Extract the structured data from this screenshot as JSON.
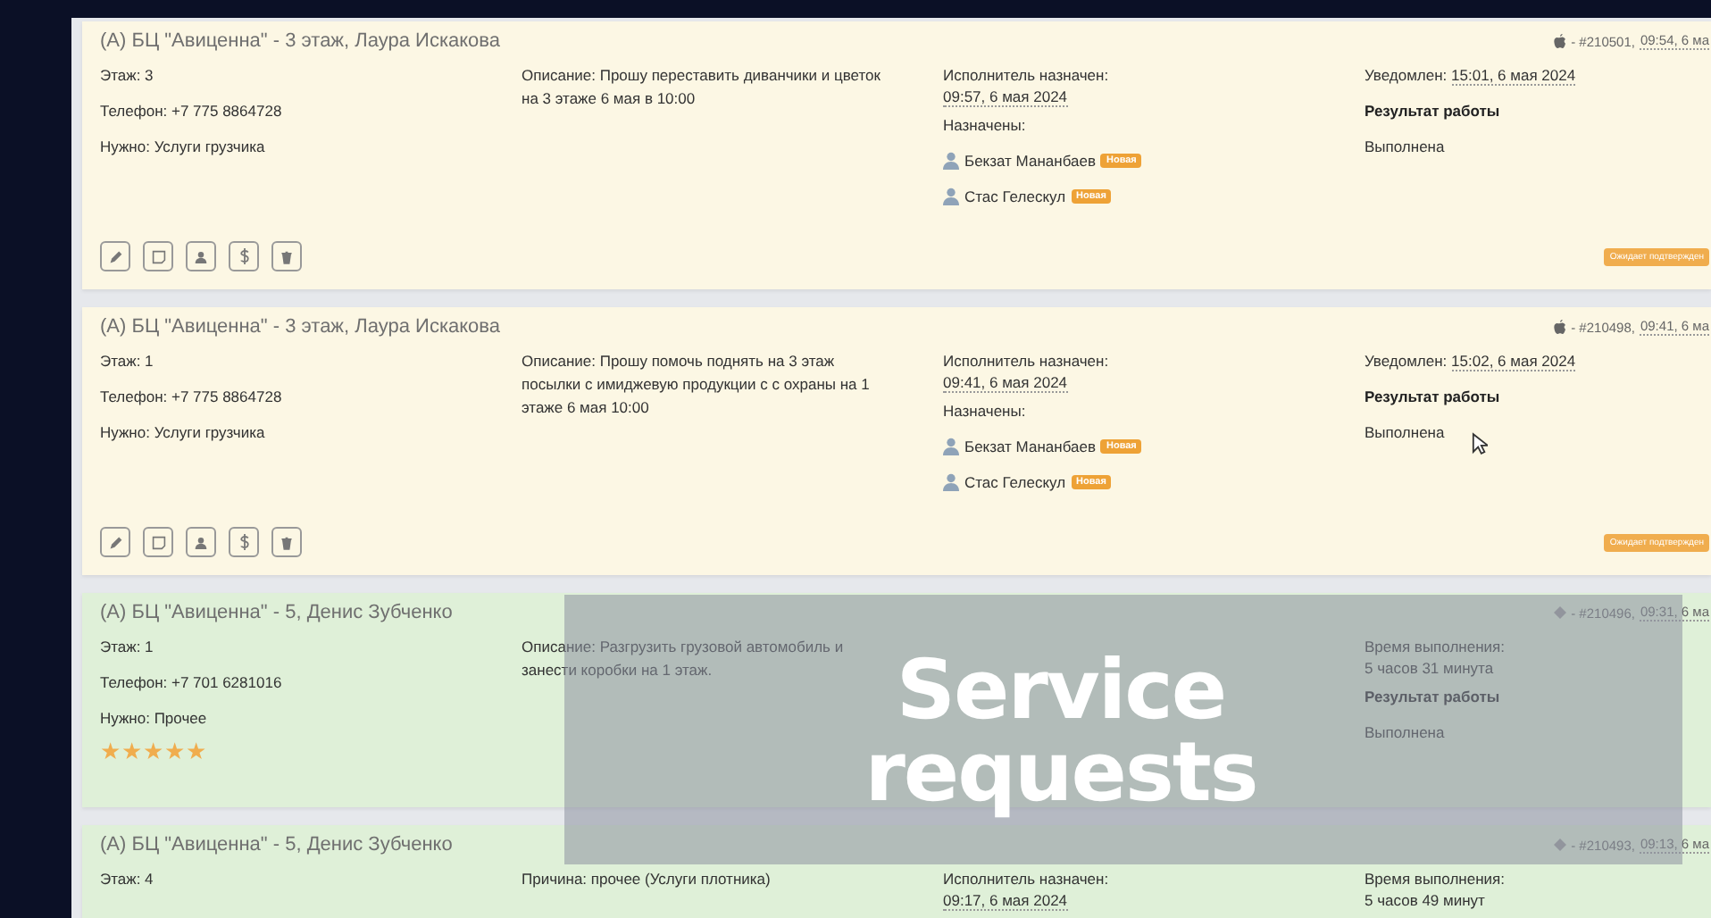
{
  "requests": [
    {
      "kind": "pending",
      "platform": {
        "kind": "apple"
      },
      "title": "(А) БЦ \"Авиценна\" - 3 этаж, Лаура Искакова",
      "meta_prefix": "- #210501,",
      "meta_time": "09:54, 6 ма",
      "fields": [
        "Этаж: 3",
        "Телефон: +7 775 8864728",
        "Нужно: Услуги грузчика"
      ],
      "description": "Описание: Прошу переставить диванчики и цветок на 3 этаже 6 мая в 10:00",
      "assigned_label": "Исполнитель назначен:",
      "assigned_time": "09:57, 6 мая 2024",
      "assignees_label": "Назначены:",
      "assignees": [
        {
          "name": "Бекзат Мананбаев",
          "badge": "Новая"
        },
        {
          "name": "Стас Гелескул",
          "badge": "Новая"
        }
      ],
      "col4_label": "Уведомлен:",
      "col4_value": "15:01, 6 мая 2024",
      "result_label": "Результат работы",
      "result": "Выполнена",
      "actions": [
        {
          "kind": "edit"
        },
        {
          "kind": "comment"
        },
        {
          "kind": "user"
        },
        {
          "kind": "money"
        },
        {
          "kind": "delete"
        }
      ],
      "status_badge": "Ожидает подтвержден"
    },
    {
      "kind": "pending",
      "platform": {
        "kind": "apple"
      },
      "title": "(А) БЦ \"Авиценна\" - 3 этаж, Лаура Искакова",
      "meta_prefix": "- #210498,",
      "meta_time": "09:41, 6 ма",
      "fields": [
        "Этаж: 1",
        "Телефон: +7 775 8864728",
        "Нужно: Услуги грузчика"
      ],
      "description": "Описание: Прошу помочь поднять на 3 этаж посылки с имиджевую продукции с с охраны на 1 этаже 6 мая 10:00",
      "assigned_label": "Исполнитель назначен:",
      "assigned_time": "09:41, 6 мая 2024",
      "assignees_label": "Назначены:",
      "assignees": [
        {
          "name": "Бекзат Мананбаев",
          "badge": "Новая"
        },
        {
          "name": "Стас Гелескул",
          "badge": "Новая"
        }
      ],
      "col4_label": "Уведомлен:",
      "col4_value": "15:02, 6 мая 2024",
      "result_label": "Результат работы",
      "result": "Выполнена",
      "actions": [
        {
          "kind": "edit"
        },
        {
          "kind": "comment"
        },
        {
          "kind": "user"
        },
        {
          "kind": "money"
        },
        {
          "kind": "delete"
        }
      ],
      "status_badge": "Ожидает подтвержден",
      "cursor": true
    },
    {
      "kind": "done",
      "platform": {
        "kind": "diamond"
      },
      "title": "(А) БЦ \"Авиценна\" - 5, Денис Зубченко",
      "meta_prefix": "- #210496,",
      "meta_time": "09:31, 6 ма",
      "fields": [
        "Этаж: 1",
        "Телефон: +7 701 6281016",
        "Нужно: Прочее"
      ],
      "stars": 5,
      "description": "Описание: Разгрузить грузовой автомобиль и занести коробки на 1 этаж.",
      "col4_label": "Время выполнения:",
      "col4_value": "5 часов 31 минута",
      "result_label": "Результат работы",
      "result": "Выполнена"
    },
    {
      "kind": "done",
      "platform": {
        "kind": "diamond"
      },
      "title": "(А) БЦ \"Авиценна\" - 5, Денис Зубченко",
      "meta_prefix": "- #210493,",
      "meta_time": "09:13, 6 ма",
      "fields": [
        "Этаж: 4"
      ],
      "description": "Причина: прочее (Услуги плотника)",
      "assigned_label": "Исполнитель назначен:",
      "assigned_time": "09:17, 6 мая 2024",
      "col4_label": "Время выполнения:",
      "col4_value": "5 часов 49 минут"
    }
  ],
  "overlay": {
    "title": "Service requests"
  }
}
